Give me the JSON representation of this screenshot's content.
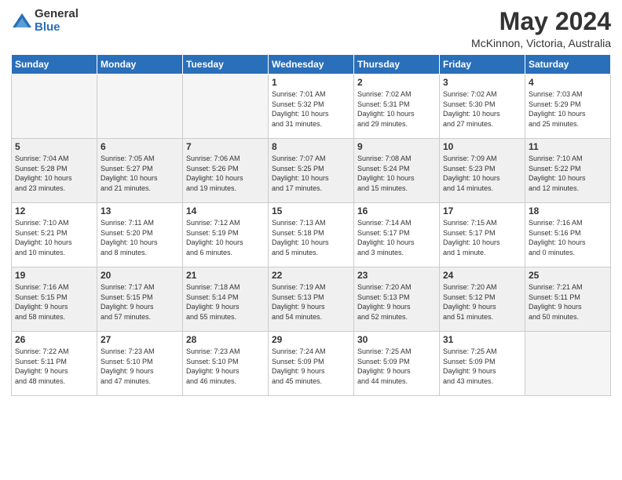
{
  "logo": {
    "general": "General",
    "blue": "Blue"
  },
  "title": "May 2024",
  "location": "McKinnon, Victoria, Australia",
  "days_of_week": [
    "Sunday",
    "Monday",
    "Tuesday",
    "Wednesday",
    "Thursday",
    "Friday",
    "Saturday"
  ],
  "weeks": [
    [
      {
        "day": "",
        "info": ""
      },
      {
        "day": "",
        "info": ""
      },
      {
        "day": "",
        "info": ""
      },
      {
        "day": "1",
        "info": "Sunrise: 7:01 AM\nSunset: 5:32 PM\nDaylight: 10 hours\nand 31 minutes."
      },
      {
        "day": "2",
        "info": "Sunrise: 7:02 AM\nSunset: 5:31 PM\nDaylight: 10 hours\nand 29 minutes."
      },
      {
        "day": "3",
        "info": "Sunrise: 7:02 AM\nSunset: 5:30 PM\nDaylight: 10 hours\nand 27 minutes."
      },
      {
        "day": "4",
        "info": "Sunrise: 7:03 AM\nSunset: 5:29 PM\nDaylight: 10 hours\nand 25 minutes."
      }
    ],
    [
      {
        "day": "5",
        "info": "Sunrise: 7:04 AM\nSunset: 5:28 PM\nDaylight: 10 hours\nand 23 minutes."
      },
      {
        "day": "6",
        "info": "Sunrise: 7:05 AM\nSunset: 5:27 PM\nDaylight: 10 hours\nand 21 minutes."
      },
      {
        "day": "7",
        "info": "Sunrise: 7:06 AM\nSunset: 5:26 PM\nDaylight: 10 hours\nand 19 minutes."
      },
      {
        "day": "8",
        "info": "Sunrise: 7:07 AM\nSunset: 5:25 PM\nDaylight: 10 hours\nand 17 minutes."
      },
      {
        "day": "9",
        "info": "Sunrise: 7:08 AM\nSunset: 5:24 PM\nDaylight: 10 hours\nand 15 minutes."
      },
      {
        "day": "10",
        "info": "Sunrise: 7:09 AM\nSunset: 5:23 PM\nDaylight: 10 hours\nand 14 minutes."
      },
      {
        "day": "11",
        "info": "Sunrise: 7:10 AM\nSunset: 5:22 PM\nDaylight: 10 hours\nand 12 minutes."
      }
    ],
    [
      {
        "day": "12",
        "info": "Sunrise: 7:10 AM\nSunset: 5:21 PM\nDaylight: 10 hours\nand 10 minutes."
      },
      {
        "day": "13",
        "info": "Sunrise: 7:11 AM\nSunset: 5:20 PM\nDaylight: 10 hours\nand 8 minutes."
      },
      {
        "day": "14",
        "info": "Sunrise: 7:12 AM\nSunset: 5:19 PM\nDaylight: 10 hours\nand 6 minutes."
      },
      {
        "day": "15",
        "info": "Sunrise: 7:13 AM\nSunset: 5:18 PM\nDaylight: 10 hours\nand 5 minutes."
      },
      {
        "day": "16",
        "info": "Sunrise: 7:14 AM\nSunset: 5:17 PM\nDaylight: 10 hours\nand 3 minutes."
      },
      {
        "day": "17",
        "info": "Sunrise: 7:15 AM\nSunset: 5:17 PM\nDaylight: 10 hours\nand 1 minute."
      },
      {
        "day": "18",
        "info": "Sunrise: 7:16 AM\nSunset: 5:16 PM\nDaylight: 10 hours\nand 0 minutes."
      }
    ],
    [
      {
        "day": "19",
        "info": "Sunrise: 7:16 AM\nSunset: 5:15 PM\nDaylight: 9 hours\nand 58 minutes."
      },
      {
        "day": "20",
        "info": "Sunrise: 7:17 AM\nSunset: 5:15 PM\nDaylight: 9 hours\nand 57 minutes."
      },
      {
        "day": "21",
        "info": "Sunrise: 7:18 AM\nSunset: 5:14 PM\nDaylight: 9 hours\nand 55 minutes."
      },
      {
        "day": "22",
        "info": "Sunrise: 7:19 AM\nSunset: 5:13 PM\nDaylight: 9 hours\nand 54 minutes."
      },
      {
        "day": "23",
        "info": "Sunrise: 7:20 AM\nSunset: 5:13 PM\nDaylight: 9 hours\nand 52 minutes."
      },
      {
        "day": "24",
        "info": "Sunrise: 7:20 AM\nSunset: 5:12 PM\nDaylight: 9 hours\nand 51 minutes."
      },
      {
        "day": "25",
        "info": "Sunrise: 7:21 AM\nSunset: 5:11 PM\nDaylight: 9 hours\nand 50 minutes."
      }
    ],
    [
      {
        "day": "26",
        "info": "Sunrise: 7:22 AM\nSunset: 5:11 PM\nDaylight: 9 hours\nand 48 minutes."
      },
      {
        "day": "27",
        "info": "Sunrise: 7:23 AM\nSunset: 5:10 PM\nDaylight: 9 hours\nand 47 minutes."
      },
      {
        "day": "28",
        "info": "Sunrise: 7:23 AM\nSunset: 5:10 PM\nDaylight: 9 hours\nand 46 minutes."
      },
      {
        "day": "29",
        "info": "Sunrise: 7:24 AM\nSunset: 5:09 PM\nDaylight: 9 hours\nand 45 minutes."
      },
      {
        "day": "30",
        "info": "Sunrise: 7:25 AM\nSunset: 5:09 PM\nDaylight: 9 hours\nand 44 minutes."
      },
      {
        "day": "31",
        "info": "Sunrise: 7:25 AM\nSunset: 5:09 PM\nDaylight: 9 hours\nand 43 minutes."
      },
      {
        "day": "",
        "info": ""
      }
    ]
  ]
}
